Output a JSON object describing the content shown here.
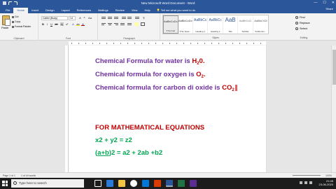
{
  "window": {
    "title": "New Microsoft Word Document - Word",
    "min": "—",
    "max": "☐",
    "close": "✕"
  },
  "tabs": [
    "File",
    "Home",
    "Insert",
    "Design",
    "Layout",
    "References",
    "Mailings",
    "Review",
    "View",
    "Help"
  ],
  "tell_me": "Tell me what you want to do",
  "share": "Share",
  "clipboard": {
    "paste": "Paste",
    "cut": "Cut",
    "copy": "Copy",
    "format_painter": "Format Painter",
    "group": "Clipboard"
  },
  "font": {
    "name": "Calibri (Body)",
    "size": "14",
    "group": "Font"
  },
  "paragraph": {
    "group": "Paragraph"
  },
  "styles": {
    "group": "Styles",
    "items": [
      {
        "sample": "AaBbCcDc",
        "name": "¶ Normal"
      },
      {
        "sample": "AaBbCcDc",
        "name": "¶ No Spac..."
      },
      {
        "sample": "AaBbCc",
        "name": "Heading 1"
      },
      {
        "sample": "AaBbCc",
        "name": "Heading 2"
      },
      {
        "sample": "AaB",
        "name": "Title"
      },
      {
        "sample": "AaBbCcD",
        "name": "Subtitle"
      },
      {
        "sample": "AaBbCcDi",
        "name": "Subtle Em..."
      }
    ]
  },
  "editing": {
    "find": "Find",
    "replace": "Replace",
    "select": "Select",
    "group": "Editing"
  },
  "document": {
    "line1": {
      "text": "Chemical Formula for water is ",
      "formula_a": "H",
      "sub": "2",
      "formula_b": "0."
    },
    "line2": {
      "text": "Chemical formula for oxygen is ",
      "formula_a": "O",
      "sub": "2",
      "formula_b": "."
    },
    "line3": {
      "text": "Chemical formula for carbon di oxide is ",
      "formula_a": "CO",
      "sub": "2"
    },
    "heading": "FOR MATHEMATICAL EQUATIONS",
    "eq1": "x2 + y2 = z2",
    "eq2_a": "(",
    "eq2_u": "a+b",
    "eq2_b": ")2 = a2 + 2ab +b2"
  },
  "status": {
    "page": "Page 1 of 1",
    "words": "1 of 44 words",
    "zoom": "100%"
  },
  "taskbar": {
    "search": "Type here to search",
    "time": "21:45",
    "date": "23-06-2020"
  }
}
